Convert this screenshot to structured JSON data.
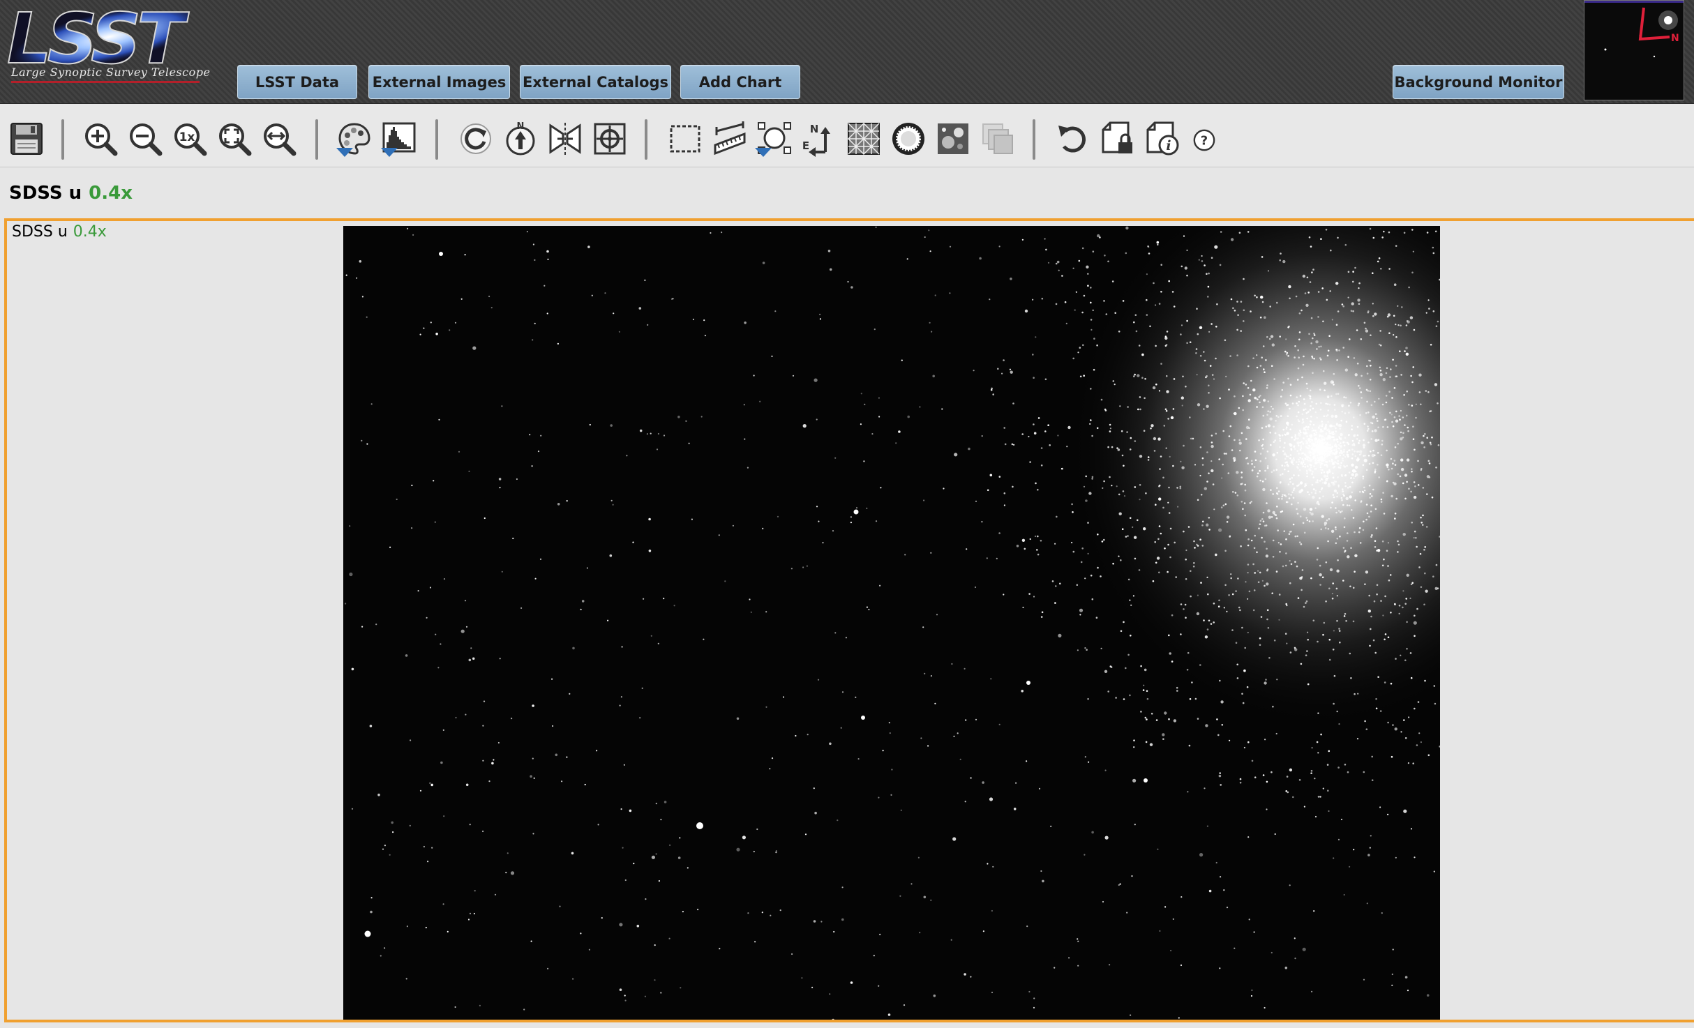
{
  "app": {
    "logo_text": "LSST",
    "logo_tagline": "Large Synoptic Survey Telescope"
  },
  "nav": {
    "lsst_data": "LSST Data",
    "external_images": "External Images",
    "external_catalogs": "External Catalogs",
    "add_chart": "Add Chart",
    "background_monitor": "Background Monitor"
  },
  "toolbar": {
    "tools": [
      {
        "name": "save",
        "icon": "floppy-disk-icon"
      },
      {
        "name": "zoom-in",
        "icon": "zoom-in-icon"
      },
      {
        "name": "zoom-out",
        "icon": "zoom-out-icon"
      },
      {
        "name": "zoom-original",
        "icon": "zoom-1x-icon",
        "text": "1x"
      },
      {
        "name": "zoom-fit",
        "icon": "zoom-fit-icon"
      },
      {
        "name": "zoom-fill",
        "icon": "zoom-fill-width-icon"
      },
      {
        "name": "color-table",
        "icon": "palette-icon"
      },
      {
        "name": "stretch",
        "icon": "histogram-icon"
      },
      {
        "name": "rotate",
        "icon": "rotate-icon"
      },
      {
        "name": "rotate-north",
        "icon": "north-up-icon",
        "text": "N"
      },
      {
        "name": "flip",
        "icon": "flip-icon"
      },
      {
        "name": "recenter",
        "icon": "crosshair-icon"
      },
      {
        "name": "select-area",
        "icon": "select-rect-icon"
      },
      {
        "name": "distance",
        "icon": "ruler-icon"
      },
      {
        "name": "marker",
        "icon": "marker-icon"
      },
      {
        "name": "north-east-arrows",
        "icon": "compass-ne-icon",
        "text": "N E"
      },
      {
        "name": "coordinate-grid",
        "icon": "grid-icon"
      },
      {
        "name": "mask",
        "icon": "starburst-icon"
      },
      {
        "name": "overlay",
        "icon": "overlay-image-icon"
      },
      {
        "name": "layers",
        "icon": "layers-icon"
      },
      {
        "name": "restore",
        "icon": "restore-icon"
      },
      {
        "name": "lock",
        "icon": "lock-file-icon"
      },
      {
        "name": "file-info",
        "icon": "file-info-icon"
      },
      {
        "name": "help",
        "icon": "help-icon",
        "text": "?"
      }
    ]
  },
  "image": {
    "title": "SDSS u",
    "zoom": "0.4x"
  },
  "thumbnail": {
    "compass_label": "N"
  },
  "colors": {
    "header_bg": "#3b3b3b",
    "button_bg": "#8fb2d0",
    "viewer_border": "#f0a030",
    "zoom_text": "#3a9a3a",
    "dropdown_marker": "#2f6fb7"
  }
}
